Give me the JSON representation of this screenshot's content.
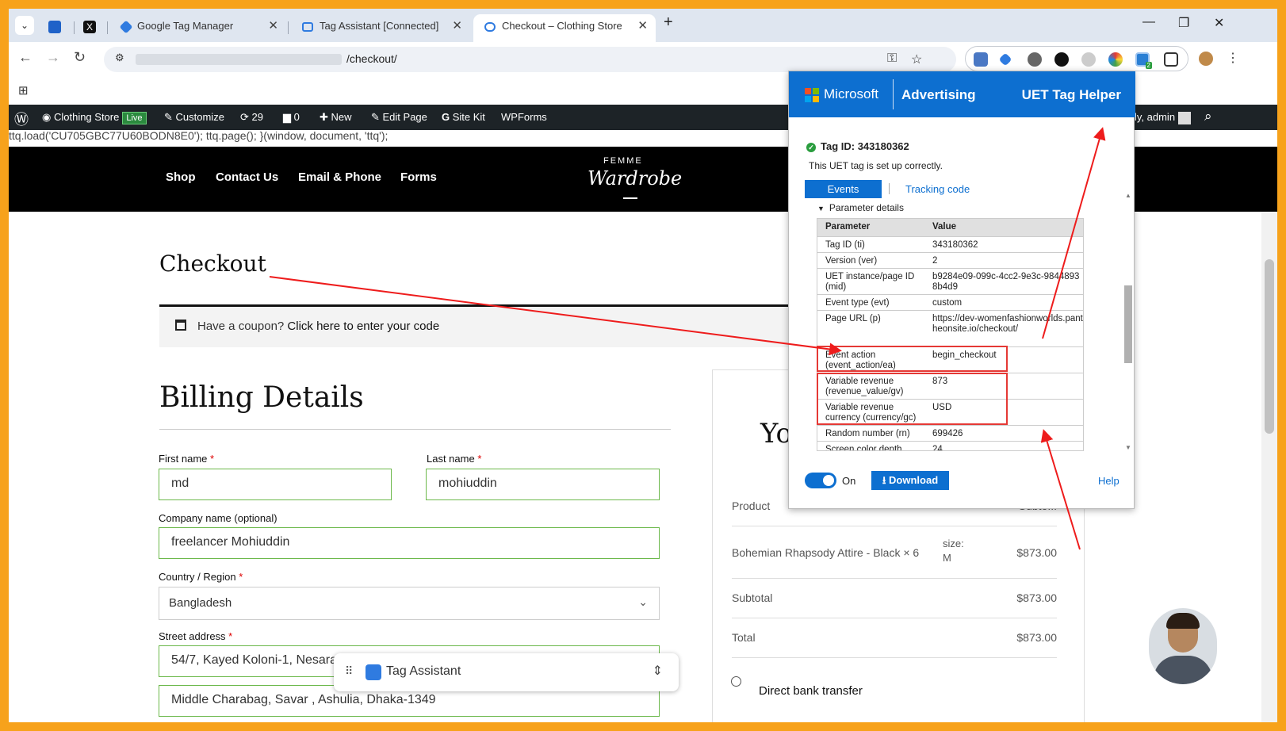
{
  "browser": {
    "tabs": [
      {
        "label": "Google Tag Manager"
      },
      {
        "label": "Tag Assistant [Connected]"
      },
      {
        "label": "Checkout – Clothing Store"
      }
    ],
    "url_path": "/checkout/",
    "ext_badge": "2"
  },
  "wp_admin": {
    "site": "Clothing Store",
    "live": "Live",
    "customize": "Customize",
    "updates": "29",
    "comments": "0",
    "new": "New",
    "edit_page": "Edit Page",
    "site_kit": "Site Kit",
    "wpforms": "WPForms",
    "howdy": "ly, admin"
  },
  "script_text": "ttq.load('CU705GBC77U60BODN8E0'); ttq.page(); }(window, document, 'ttq');",
  "site": {
    "menu": [
      "Shop",
      "Contact Us",
      "Email & Phone",
      "Forms"
    ],
    "logo_top": "FEMME",
    "logo_main": "Wardrobe"
  },
  "checkout": {
    "title": "Checkout",
    "coupon_text": "Have a coupon?",
    "coupon_link": "Click here to enter your code",
    "billing_title": "Billing Details",
    "first_name_label": "First name",
    "first_name": "md",
    "last_name_label": "Last name",
    "last_name": "mohiuddin",
    "company_label": "Company name (optional)",
    "company": "freelancer Mohiuddin",
    "country_label": "Country / Region",
    "country": "Bangladesh",
    "street_label": "Street address",
    "street1": "54/7, Kayed Koloni-1, Nesarabad, Jhalakathi sadar, Jhalakathi-8400.",
    "street2": "Middle Charabag, Savar , Ashulia, Dhaka-1349",
    "required": "*"
  },
  "order": {
    "title_partial": "Yo",
    "product_hdr": "Product",
    "subtotal_hdr": "Subto...",
    "product_name": "Bohemian Rhapsody Attire - Black × 6",
    "product_meta": "size:\nM",
    "product_price": "$873.00",
    "subtotal_label": "Subtotal",
    "subtotal": "$873.00",
    "total_label": "Total",
    "total": "$873.00",
    "payment_option": "Direct bank transfer"
  },
  "uet": {
    "brand": "Microsoft",
    "advertising": "Advertising",
    "helper": "UET Tag Helper",
    "tag_id": "Tag ID: 343180362",
    "status": "This UET tag is set up correctly.",
    "tab_events": "Events",
    "tab_tracking": "Tracking code",
    "section": "Parameter details",
    "col_param": "Parameter",
    "col_value": "Value",
    "rows": [
      {
        "k": "Tag ID (ti)",
        "v": "343180362"
      },
      {
        "k": "Version (ver)",
        "v": "2"
      },
      {
        "k": "UET instance/page ID (mid)",
        "v": "b9284e09-099c-4cc2-9e3c-98448938b4d9"
      },
      {
        "k": "Event type (evt)",
        "v": "custom"
      },
      {
        "k": "Page URL (p)",
        "v": "https://dev-womenfashionworlds.pantheonsite.io/checkout/"
      },
      {
        "k": "Event action (event_action/ea)",
        "v": "begin_checkout"
      },
      {
        "k": "Variable revenue (revenue_value/gv)",
        "v": "873"
      },
      {
        "k": "Variable revenue currency (currency/gc)",
        "v": "USD"
      },
      {
        "k": "Random number (rn)",
        "v": "699426"
      },
      {
        "k": "Screen color depth",
        "v": "24"
      }
    ],
    "toggle_label": "On",
    "download": "Download",
    "help": "Help"
  },
  "tag_assistant": {
    "label": "Tag Assistant"
  },
  "colors": {
    "accent": "#0d6fd0",
    "border": "#f7a21b",
    "highlight": "#e53935",
    "field_border": "#6bb84a"
  }
}
